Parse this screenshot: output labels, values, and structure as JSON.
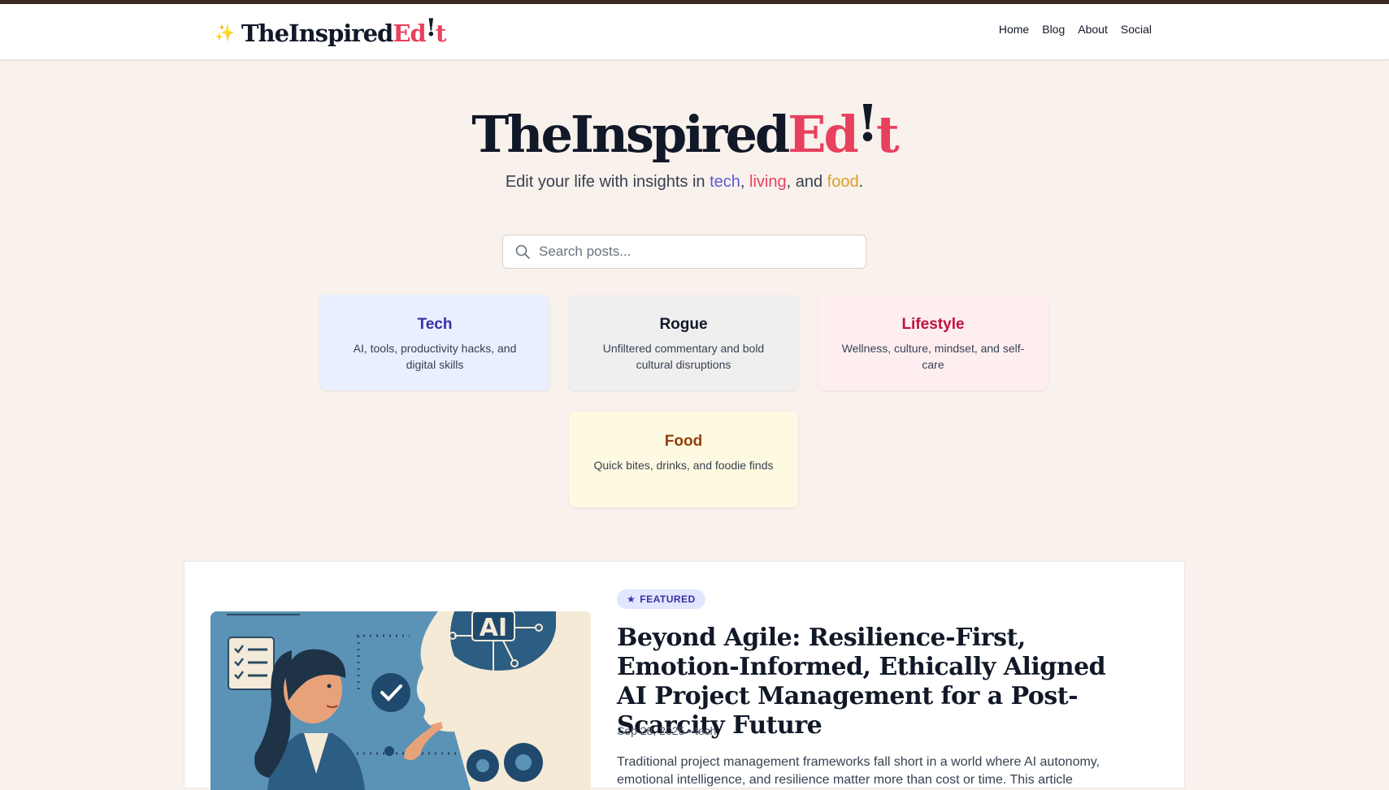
{
  "header": {
    "logo_main": "TheInspired",
    "logo_ed": "Ed",
    "logo_bang": "!",
    "logo_t": "t",
    "nav": [
      {
        "label": "Home"
      },
      {
        "label": "Blog"
      },
      {
        "label": "About"
      },
      {
        "label": "Social"
      }
    ]
  },
  "hero": {
    "title_main": "TheInspired",
    "title_ed": "Ed",
    "title_bang": "!",
    "title_t": "t",
    "tagline_prefix": "Edit your life with insights in ",
    "tagline_tech": "tech",
    "tagline_sep1": ", ",
    "tagline_living": "living",
    "tagline_sep2": ", and ",
    "tagline_food": "food",
    "tagline_end": "."
  },
  "search": {
    "placeholder": "Search posts...",
    "value": ""
  },
  "categories": [
    {
      "name": "Tech",
      "description": "AI, tools, productivity hacks, and digital skills"
    },
    {
      "name": "Rogue",
      "description": "Unfiltered commentary and bold cultural disruptions"
    },
    {
      "name": "Lifestyle",
      "description": "Wellness, culture, mindset, and self-care"
    },
    {
      "name": "Food",
      "description": "Quick bites, drinks, and foodie finds"
    }
  ],
  "featured": {
    "badge": "FEATURED",
    "title": "Beyond Agile: Resilience-First, Emotion-Informed, Ethically Aligned AI Project Management for a Post-Scarcity Future",
    "date": "Sep 28, 2025",
    "separator": "•",
    "category": "tech",
    "excerpt": "Traditional project management frameworks fall short in a world where AI autonomy, emotional intelligence, and resilience matter more than cost or time. This article",
    "image_text": "AI"
  },
  "colors": {
    "accent_red": "#e8405d",
    "tech_blue": "#5b5bd6",
    "food_gold": "#d9a226",
    "background": "#f9f1ec"
  }
}
